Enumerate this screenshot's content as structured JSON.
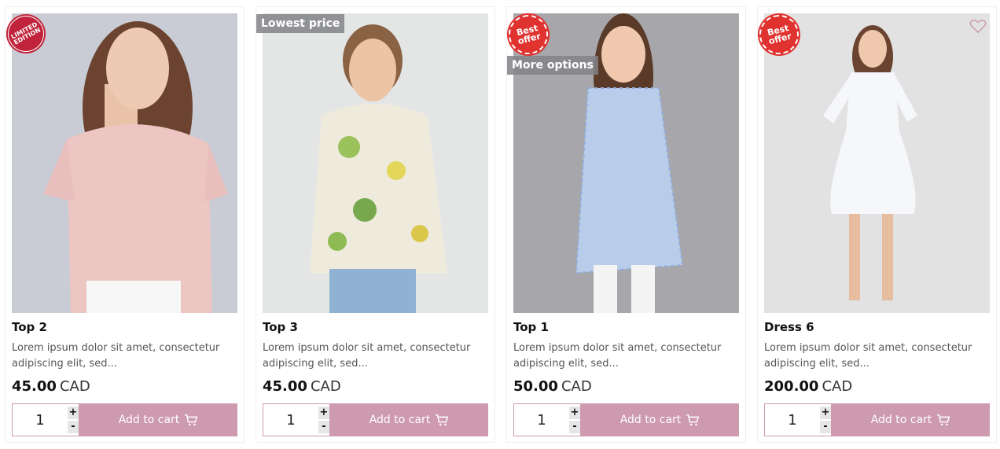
{
  "accent_color": "#cd9ab0",
  "products": [
    {
      "title": "Top 2",
      "description": "Lorem ipsum dolor sit amet, consectetur adipiscing elit, sed...",
      "price": "45.00",
      "currency": "CAD",
      "quantity": "1",
      "add_to_cart": "Add to cart",
      "seal": "LIMITED EDITION",
      "badges": []
    },
    {
      "title": "Top 3",
      "description": "Lorem ipsum dolor sit amet, consectetur adipiscing elit, sed...",
      "price": "45.00",
      "currency": "CAD",
      "quantity": "1",
      "add_to_cart": "Add to cart",
      "badges": [
        "Lowest price"
      ]
    },
    {
      "title": "Top 1",
      "description": "Lorem ipsum dolor sit amet, consectetur adipiscing elit, sed...",
      "price": "50.00",
      "currency": "CAD",
      "quantity": "1",
      "add_to_cart": "Add to cart",
      "seal": "Best offer",
      "badges": [
        "More options"
      ]
    },
    {
      "title": "Dress 6",
      "description": "Lorem ipsum dolor sit amet, consectetur adipiscing elit, sed...",
      "price": "200.00",
      "currency": "CAD",
      "quantity": "1",
      "add_to_cart": "Add to cart",
      "seal": "Best offer",
      "badges": [],
      "wishlist_icon": "heart-outline-icon"
    }
  ],
  "stepper": {
    "plus": "+",
    "minus": "-"
  }
}
